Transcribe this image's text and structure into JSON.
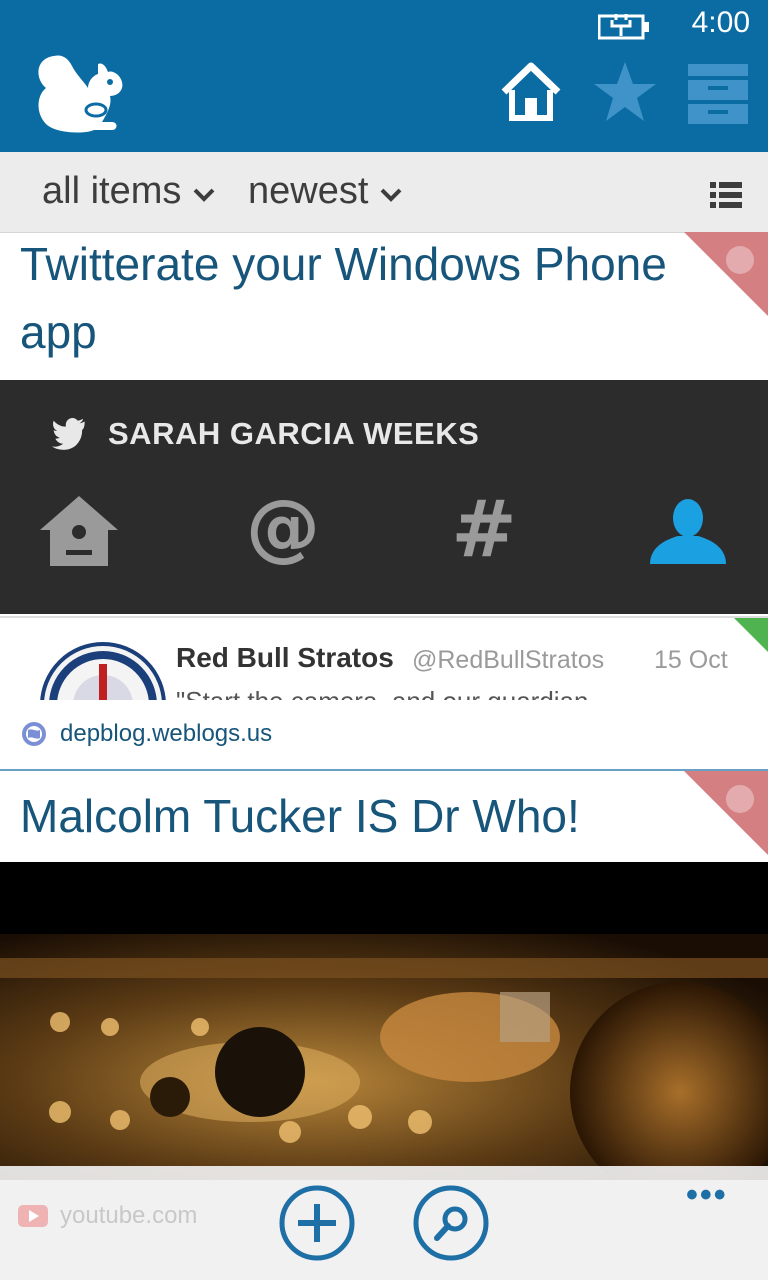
{
  "status": {
    "time": "4:00"
  },
  "header": {
    "logo": "squirrel-logo",
    "nav": [
      "home-icon",
      "star-icon",
      "archive-icon"
    ]
  },
  "filters": {
    "items_label": "all items",
    "sort_label": "newest"
  },
  "articles": [
    {
      "title": "Twitterate your Windows Phone app",
      "image": {
        "account_name": "SARAH GARCIA WEEKS",
        "tabs": [
          "home-icon",
          "at-icon",
          "hash-icon",
          "profile-icon"
        ],
        "tweet": {
          "name": "Red Bull Stratos",
          "handle": "@RedBullStratos",
          "date": "15 Oct",
          "text": "\"Start the camera, and our guardian"
        }
      },
      "source": "depblog.weblogs.us"
    },
    {
      "title": "Malcolm Tucker IS Dr Who!",
      "source": "youtube.com"
    }
  ],
  "appbar": {
    "buttons": [
      "add-icon",
      "search-icon"
    ],
    "more": "•••"
  },
  "colors": {
    "header": "#0a6ca3",
    "title": "#17557b",
    "corner": "#d47f82",
    "filterbar": "#ececec"
  }
}
